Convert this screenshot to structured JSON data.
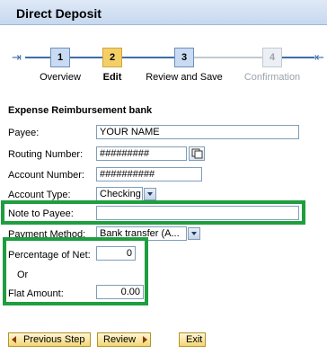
{
  "window": {
    "title": "Direct Deposit"
  },
  "roadmap": {
    "steps": [
      {
        "number": "1",
        "label": "Overview",
        "state": "completed"
      },
      {
        "number": "2",
        "label": "Edit",
        "state": "active"
      },
      {
        "number": "3",
        "label": "Review and Save",
        "state": "upcoming"
      },
      {
        "number": "4",
        "label": "Confirmation",
        "state": "disabled"
      }
    ]
  },
  "form": {
    "section_title": "Expense Reimbursement bank",
    "payee": {
      "label": "Payee:",
      "value": "YOUR NAME"
    },
    "routing_number": {
      "label": "Routing Number:",
      "value": "#########"
    },
    "account_number": {
      "label": "Account Number:",
      "value": "##########"
    },
    "account_type": {
      "label": "Account Type:",
      "value": "Checking"
    },
    "note_to_payee": {
      "label": "Note to Payee:",
      "value": ""
    },
    "payment_method": {
      "label": "Payment Method:",
      "value": "Bank transfer (A..."
    },
    "percentage_of_net": {
      "label": "Percentage of Net:",
      "value": "0"
    },
    "or_text": "Or",
    "flat_amount": {
      "label": "Flat Amount:",
      "value": "0.00"
    }
  },
  "buttons": {
    "previous_step": "Previous Step",
    "review": "Review",
    "exit": "Exit"
  },
  "colors": {
    "highlight": "#1e9e3f",
    "active_step": "#f3cf67",
    "step": "#c9dbf2",
    "roadmap_line": "#3e6ea8"
  }
}
